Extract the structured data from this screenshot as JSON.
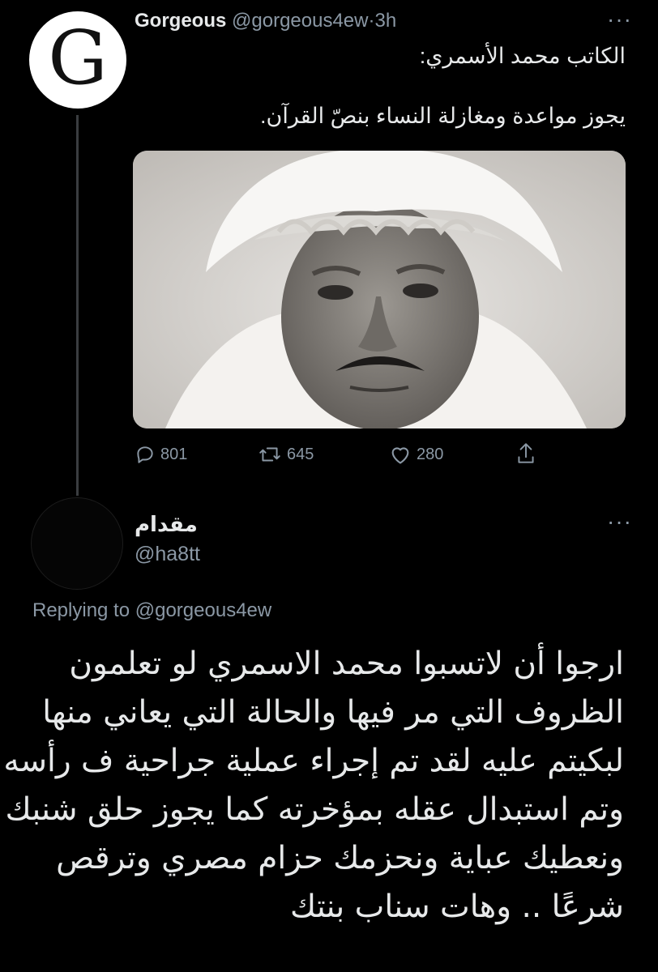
{
  "tweet": {
    "author_initial": "G",
    "author_name": "Gorgeous",
    "author_handle": "@gorgeous4ew",
    "separator": "·",
    "time": "3h",
    "more": "···",
    "text_line1": "الكاتب محمد الأسمري:",
    "text_line2": "يجوز مواعدة ومغازلة النساء بنصّ القرآن.",
    "image_icon": "portrait-photo",
    "stats": {
      "replies": "801",
      "retweets": "645",
      "likes": "280"
    }
  },
  "reply": {
    "author_name": "مقدام",
    "author_handle": "@ha8tt",
    "more": "···",
    "replying_prefix": "Replying to",
    "replying_to": "@gorgeous4ew",
    "lines": [
      "ارجوا أن لاتسبوا محمد الاسمري لو تعلمون",
      "الظروف التي مر فيها والحالة التي يعاني منها",
      "لبكيتم عليه لقد تم إجراء عملية جراحية ف رأسه",
      "وتم استبدال عقله بمؤخرته كما يجوز حلق شنبك",
      "ونعطيك عباية ونحزمك حزام مصري وترقص",
      "شرعًا .. وهات سناب بنتك"
    ]
  },
  "colors": {
    "background": "#000000",
    "text": "#e7e9ea",
    "secondary": "#8b98a5"
  }
}
